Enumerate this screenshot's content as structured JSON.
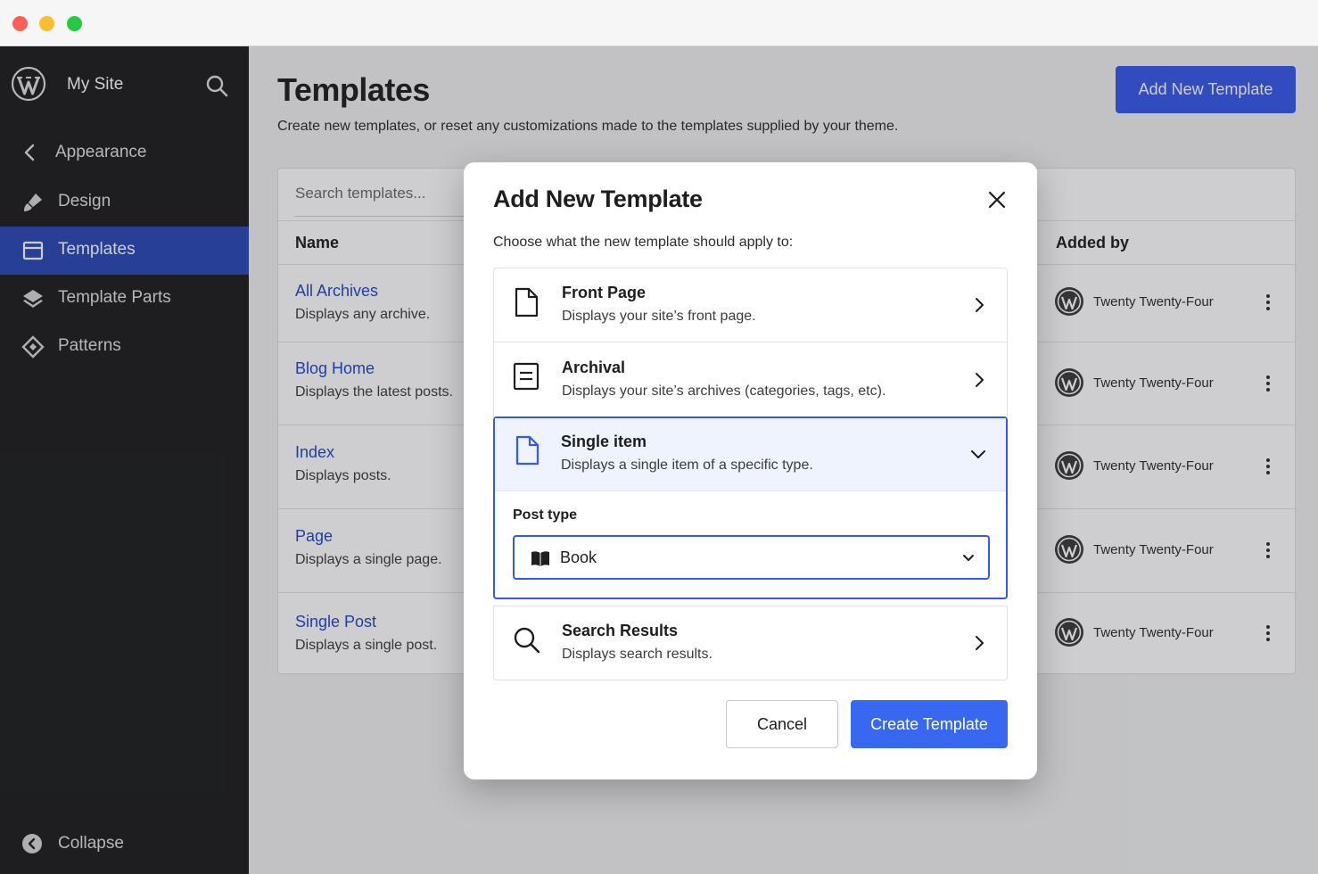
{
  "sidebar": {
    "site_name": "My Site",
    "back_label": "Appearance",
    "items": [
      {
        "label": "Design",
        "icon": "brush-icon"
      },
      {
        "label": "Templates",
        "icon": "layout-icon",
        "active": true
      },
      {
        "label": "Template Parts",
        "icon": "layers-icon"
      },
      {
        "label": "Patterns",
        "icon": "diamond-icon"
      }
    ],
    "collapse_label": "Collapse"
  },
  "main": {
    "title": "Templates",
    "description": "Create new templates, or reset any customizations made to the templates supplied by your theme.",
    "add_button": "Add New Template",
    "search_placeholder": "Search templates...",
    "columns": {
      "name": "Name",
      "added_by": "Added by"
    },
    "rows": [
      {
        "title": "All Archives",
        "desc": "Displays any archive.",
        "added_by": "Twenty Twenty-Four"
      },
      {
        "title": "Blog Home",
        "desc": "Displays the latest posts.",
        "added_by": "Twenty Twenty-Four"
      },
      {
        "title": "Index",
        "desc": "Displays posts.",
        "added_by": "Twenty Twenty-Four"
      },
      {
        "title": "Page",
        "desc": "Displays a single page.",
        "added_by": "Twenty Twenty-Four"
      },
      {
        "title": "Single Post",
        "desc": "Displays a single post.",
        "added_by": "Twenty Twenty-Four"
      }
    ]
  },
  "modal": {
    "title": "Add New Template",
    "subtitle": "Choose what the new template should apply to:",
    "options": [
      {
        "title": "Front Page",
        "desc": "Displays your site’s front page.",
        "icon": "page-icon"
      },
      {
        "title": "Archival",
        "desc": "Displays your site’s archives (categories, tags, etc).",
        "icon": "archive-icon"
      },
      {
        "title": "Single item",
        "desc": "Displays a single item of a specific type.",
        "icon": "page-icon",
        "expanded": true
      },
      {
        "title": "Search Results",
        "desc": "Displays search results.",
        "icon": "search-icon"
      }
    ],
    "post_type_label": "Post type",
    "post_type_value": "Book",
    "cancel": "Cancel",
    "create": "Create Template"
  },
  "colors": {
    "accent": "#3858e9",
    "sidebar_bg": "#1e1e1e",
    "active_nav": "#2948b7",
    "link": "#2148c7"
  }
}
